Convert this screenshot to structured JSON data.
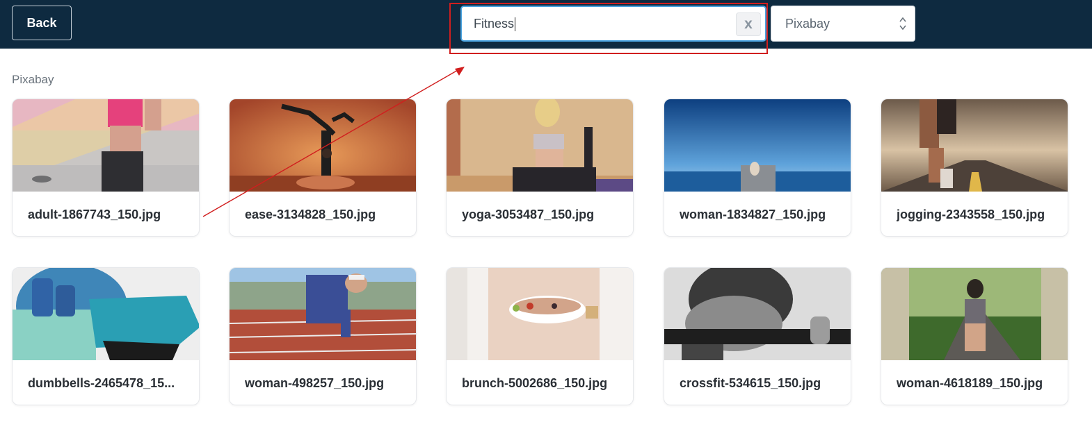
{
  "header": {
    "back_label": "Back",
    "search": {
      "value": "Fitness",
      "clear_label": "x"
    },
    "source_select": {
      "selected": "Pixabay"
    }
  },
  "section": {
    "label": "Pixabay"
  },
  "images": [
    {
      "name": "adult-1867743_150.jpg"
    },
    {
      "name": "ease-3134828_150.jpg"
    },
    {
      "name": "yoga-3053487_150.jpg"
    },
    {
      "name": "woman-1834827_150.jpg"
    },
    {
      "name": "jogging-2343558_150.jpg"
    },
    {
      "name": "dumbbells-2465478_15..."
    },
    {
      "name": "woman-498257_150.jpg"
    },
    {
      "name": "brunch-5002686_150.jpg"
    },
    {
      "name": "crossfit-534615_150.jpg"
    },
    {
      "name": "woman-4618189_150.jpg"
    }
  ],
  "colors": {
    "header_bg": "#0e2a40",
    "search_border": "#4aa3e0",
    "annotation_red": "#d11e1e"
  }
}
